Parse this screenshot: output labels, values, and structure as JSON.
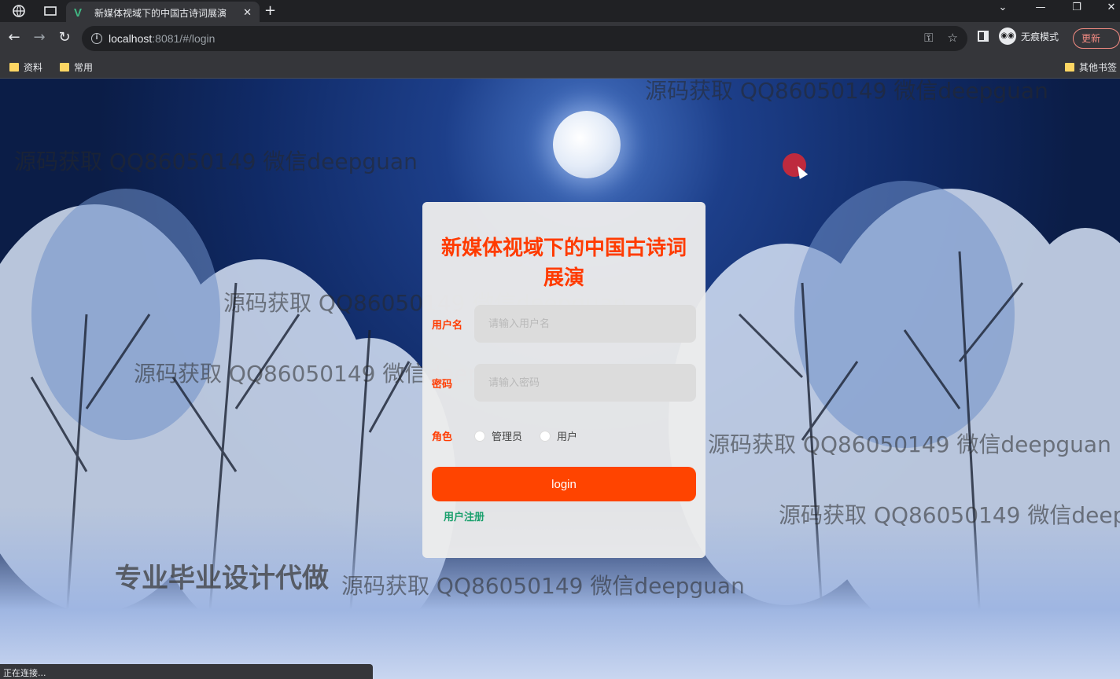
{
  "browser": {
    "tab_title": "新媒体视域下的中国古诗词展演",
    "tab_close": "✕",
    "new_tab": "+",
    "url_host": "localhost",
    "url_rest": ":8081/#/login",
    "profile_label": "无痕模式",
    "update_label": "更新",
    "bookmarks": [
      "资料",
      "常用"
    ],
    "other_bookmarks": "其他书签",
    "window_controls": [
      "⌄",
      "—",
      "❐",
      "✕"
    ]
  },
  "login": {
    "title": "新媒体视域下的中国古诗词展演",
    "username_label": "用户名",
    "username_placeholder": "请输入用户名",
    "password_label": "密码",
    "password_placeholder": "请输入密码",
    "role_label": "角色",
    "role_options": [
      "管理员",
      "用户"
    ],
    "login_button": "login",
    "register_link": "用户注册"
  },
  "watermarks": {
    "text": "源码获取 QQ86050149 微信deepguan",
    "bottom_text": "专业毕业设计代做"
  },
  "status": "正在连接...",
  "colors": {
    "accent": "#ff3b00",
    "button": "#ff4400",
    "link": "#1aa06d"
  }
}
